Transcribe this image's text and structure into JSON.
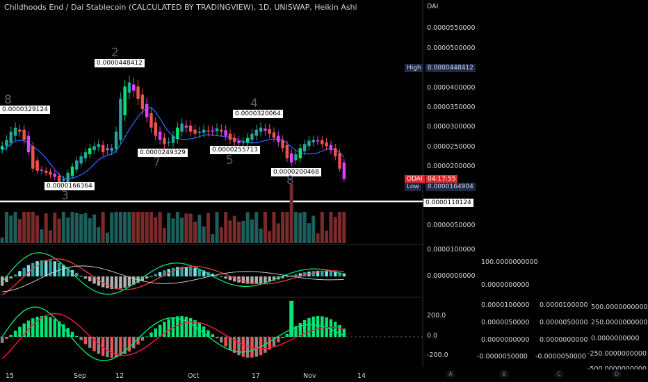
{
  "title": "Childhoods End / Dai Stablecoin (CALCULATED BY TRADINGVIEW), 1D, UNISWAP, Heikin Ashi",
  "axis_currency": "DAI",
  "price_axis": [
    "0.0000550000",
    "0.0000500000",
    "0.0000400000",
    "0.0000350000",
    "0.0000300000",
    "0.0000250000",
    "0.0000200000",
    "0.0000050000"
  ],
  "price_tags": {
    "high_label": "High",
    "high_value": "0.0000448412",
    "ticker": "ODAI",
    "countdown": "04:17:55",
    "low_label": "Low",
    "low_value": "0.0000164904",
    "line_value": "0.0000110124"
  },
  "peaks": [
    {
      "price": "0.0000329124",
      "wave": "8"
    },
    {
      "price": "0.0000448412",
      "wave": "2"
    },
    {
      "price": "0.0000320064",
      "wave": "4"
    }
  ],
  "troughs": [
    {
      "price": "0.0000166364",
      "wave": "3"
    },
    {
      "price": "0.0000249329",
      "wave": "7"
    },
    {
      "price": "0.0000255713",
      "wave": "5"
    },
    {
      "price": "0.0000200468",
      "wave": "8"
    }
  ],
  "macd_axis": [
    "0.0000100000",
    "0.0000000000"
  ],
  "macd_values": [
    "100.0000000000",
    "0.0000000000"
  ],
  "osc_axis": [
    "200.0",
    "0.0",
    "-200.0"
  ],
  "osc_value_columns": [
    [
      "0.0000100000",
      "0.0000050000",
      "0.0000000000",
      "-0.0000050000"
    ],
    [
      "0.0000100000",
      "0.0000050000",
      "0.0000000000",
      "-0.0000050000"
    ],
    [
      "500.0000000000",
      "250.0000000000",
      "0.0000000000",
      "-250.0000000000",
      "-500.0000000000"
    ]
  ],
  "bottom_letters": [
    "A",
    "B",
    "C",
    "D"
  ],
  "chart_data": {
    "type": "candlestick",
    "title": "Childhoods End / Dai Stablecoin (CALCULATED BY TRADINGVIEW), 1D, UNISWAP, Heikin Ashi",
    "x_ticks": [
      "15",
      "Sep",
      "12",
      "Oct",
      "17",
      "Nov",
      "14"
    ],
    "ylim": [
      1.2e-05,
      5.7e-05
    ],
    "horizontal_line": 1.10124e-05,
    "close": [
      2.65e-05,
      2.8e-05,
      3e-05,
      3.1e-05,
      3e-05,
      2.8e-05,
      2.5e-05,
      2.1e-05,
      2.05e-05,
      2.05e-05,
      2e-05,
      1.95e-05,
      1.9e-05,
      1.7e-05,
      1.85e-05,
      2e-05,
      2.15e-05,
      2.3e-05,
      2.4e-05,
      2.5e-05,
      2.6e-05,
      2.65e-05,
      2.7e-05,
      2.5e-05,
      2.55e-05,
      2.6e-05,
      3e-05,
      3.8e-05,
      4.1e-05,
      4.2e-05,
      4e-05,
      3.8e-05,
      3.55e-05,
      3.35e-05,
      3.1e-05,
      2.9e-05,
      2.8e-05,
      2.7e-05,
      2.75e-05,
      2.9e-05,
      3.1e-05,
      3.2e-05,
      3.1e-05,
      3e-05,
      2.95e-05,
      3e-05,
      3.05e-05,
      3e-05,
      3.02e-05,
      3.08e-05,
      3e-05,
      2.9e-05,
      2.8e-05,
      2.75e-05,
      2.72e-05,
      2.75e-05,
      2.85e-05,
      2.95e-05,
      3.05e-05,
      3.1e-05,
      3.02e-05,
      2.95e-05,
      2.85e-05,
      2.75e-05,
      2.6e-05,
      2.35e-05,
      2.25e-05,
      2.45e-05,
      2.6e-05,
      2.7e-05,
      2.78e-05,
      2.8e-05,
      2.78e-05,
      2.7e-05,
      2.65e-05,
      2.55e-05,
      2.4e-05,
      2.1e-05,
      1.85e-05
    ]
  }
}
